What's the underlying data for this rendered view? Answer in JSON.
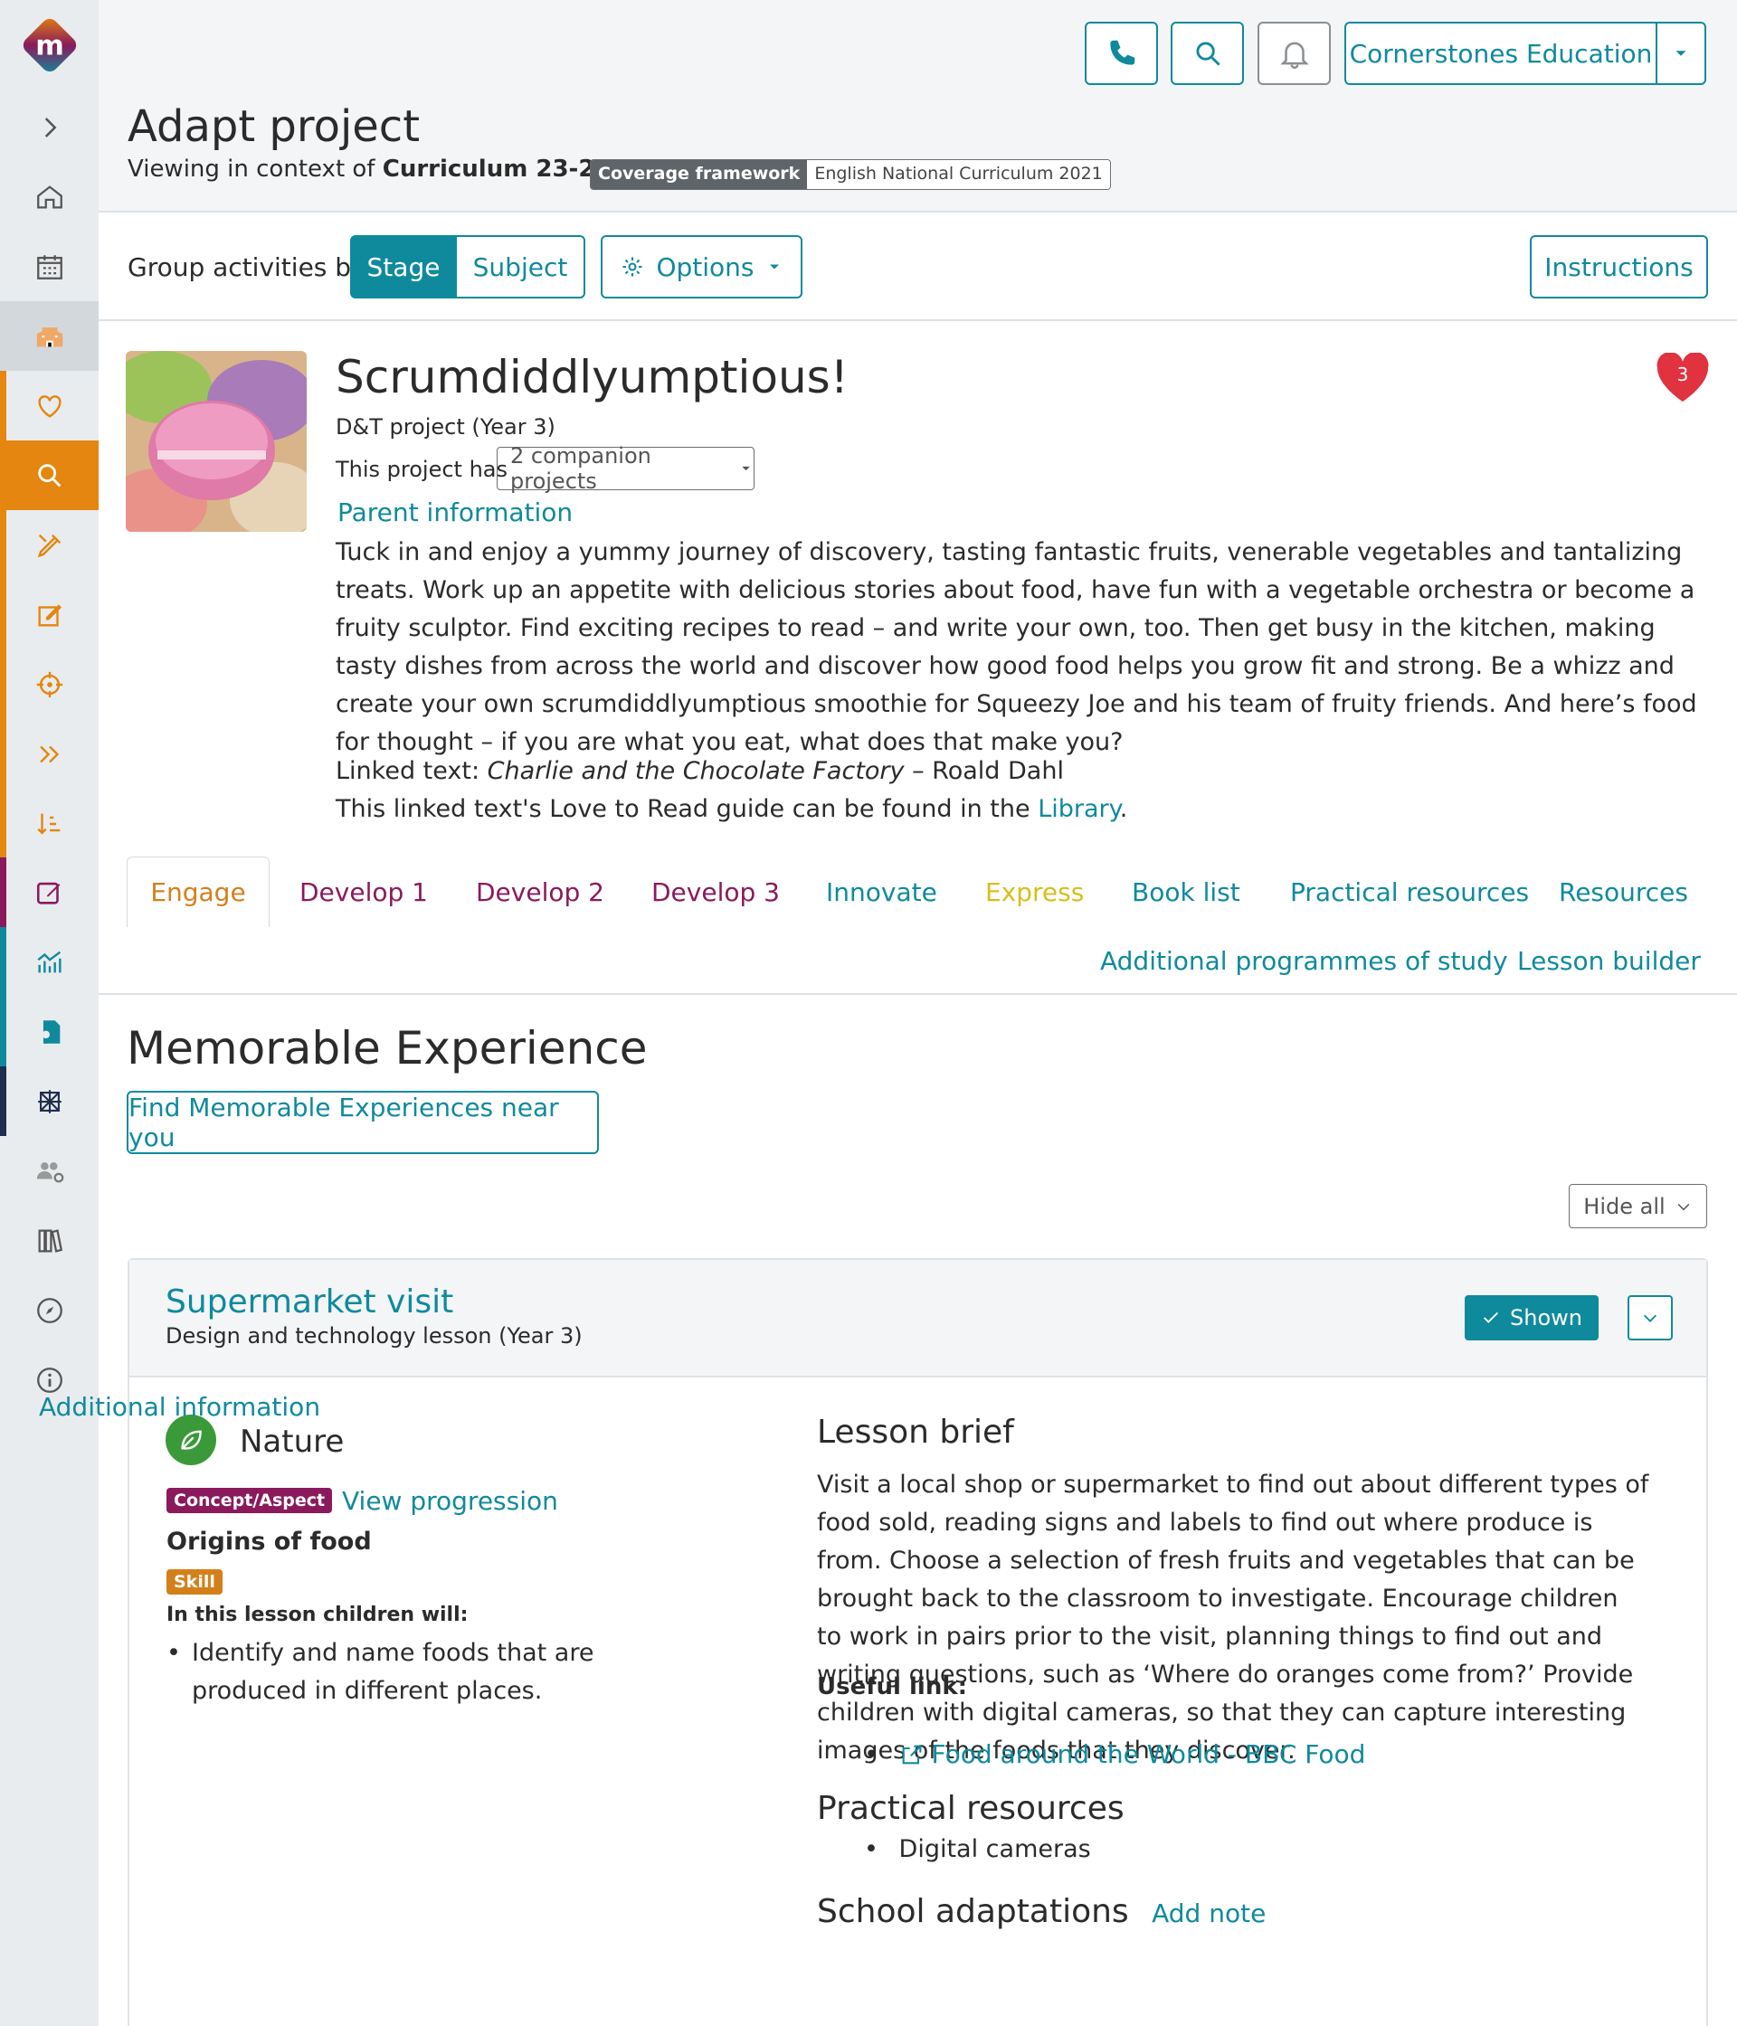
{
  "header": {
    "company_button": "Cornerstones Education",
    "page_title": "Adapt project",
    "context_prefix": "Viewing in context of",
    "context_value": "Curriculum 23-24",
    "coverage_key": "Coverage framework",
    "coverage_value": "English National Curriculum 2021"
  },
  "options_bar": {
    "group_label": "Group activities by",
    "stage": "Stage",
    "subject": "Subject",
    "options": "Options",
    "instructions": "Instructions"
  },
  "project": {
    "title": "Scrumdiddlyumptious!",
    "subtitle": "D&T project (Year 3)",
    "has_label": "This project has",
    "companion": "2 companion projects",
    "parent_info": "Parent information",
    "description": "Tuck in and enjoy a yummy journey of discovery, tasting fantastic fruits, venerable vegetables and tantalizing treats. Work up an appetite with delicious stories about food, have fun with a vegetable orchestra or become a fruity sculptor. Find exciting recipes to read – and write your own, too. Then get busy in the kitchen, making tasty dishes from across the world and discover how good food helps you grow fit and strong. Be a whizz and create your own scrumdiddlyumptious smoothie for Squeezy Joe and his team of fruity friends. And here’s food for thought – if you are what you eat, what does that make you?",
    "linked_prefix": "Linked text:",
    "linked_title": "Charlie and the Chocolate Factory",
    "linked_author": "– Roald Dahl",
    "library_prefix": "This linked text's Love to Read guide can be found in the",
    "library_link": "Library",
    "library_suffix": ".",
    "favourites": "3"
  },
  "tabs": [
    {
      "label": "Engage",
      "color": "#d4801a"
    },
    {
      "label": "Develop 1",
      "color": "#8a1a5c"
    },
    {
      "label": "Develop 2",
      "color": "#8a1a5c"
    },
    {
      "label": "Develop 3",
      "color": "#8a1a5c"
    },
    {
      "label": "Innovate",
      "color": "#0f8a9d"
    },
    {
      "label": "Express",
      "color": "#d4c01a"
    },
    {
      "label": "Book list",
      "color": "#0f8a9d"
    },
    {
      "label": "Practical resources",
      "color": "#0f8a9d"
    },
    {
      "label": "Resources",
      "color": "#0f8a9d"
    },
    {
      "label": "Additional programmes of study",
      "color": "#0f8a9d"
    },
    {
      "label": "Lesson builder",
      "color": "#0f8a9d"
    }
  ],
  "section": {
    "title": "Memorable Experience",
    "find_button": "Find Memorable Experiences near you",
    "hide_all": "Hide all"
  },
  "card": {
    "title": "Supermarket visit",
    "subtitle": "Design and technology lesson (Year 3)",
    "shown": "Shown",
    "theme": "Nature",
    "concept_badge": "Concept/Aspect",
    "view_progression": "View progression",
    "concept": "Origins of food",
    "skill_badge": "Skill",
    "lesson_will": "In this lesson children will:",
    "bullet": "Identify and name foods that are produced in different places.",
    "additional": "Additional information",
    "brief_title": "Lesson brief",
    "brief": "Visit a local shop or supermarket to find out about different types of food sold, reading signs and labels to find out where produce is from. Choose a selection of fresh fruits and vegetables that can be brought back to the classroom to investigate. Encourage children to work in pairs prior to the visit, planning things to find out and writing questions, such as ‘Where do oranges come from?’ Provide children with digital cameras, so that they can capture interesting images of the foods that they discover.",
    "useful_label": "Useful link:",
    "useful_link": "Food around the World - BBC Food",
    "practical_title": "Practical resources",
    "practical_item": "Digital cameras",
    "adaptations_title": "School adaptations",
    "adaptations_link": "Add note"
  },
  "colors": {
    "accent": "#0f8a9d",
    "orange": "#e4860f",
    "plum": "#8a1a5c",
    "navy": "#1f2d4e"
  }
}
